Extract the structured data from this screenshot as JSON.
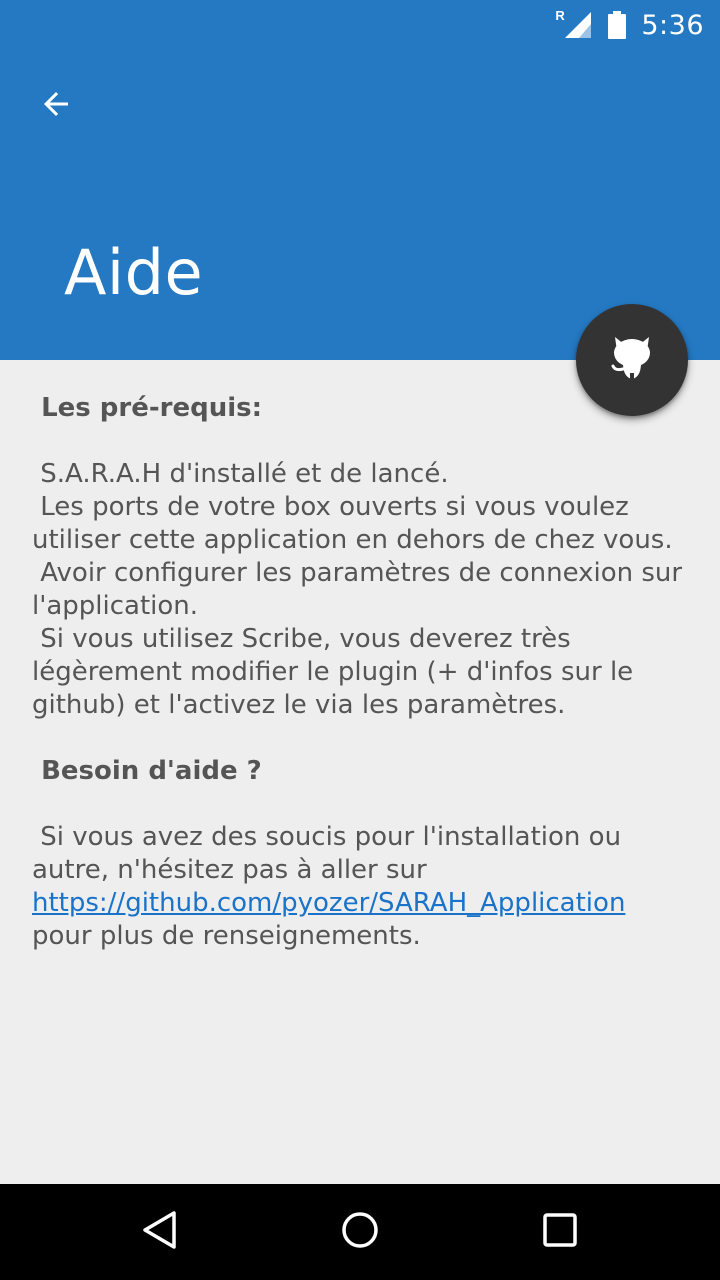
{
  "status_bar": {
    "time": "5:36",
    "network_label": "R",
    "signal_icon": "signal-roaming-icon",
    "battery_icon": "battery-full-icon"
  },
  "app_bar": {
    "back_icon": "arrow-back-icon",
    "title": "Aide",
    "color": "#2479c2"
  },
  "fab": {
    "icon": "github-octocat-icon",
    "color": "#333333"
  },
  "content": {
    "prereq_heading": "Les pré-requis:",
    "prereq_lines": [
      "S.A.R.A.H d'installé et de lancé.",
      "Les ports de votre box ouverts si vous voulez utiliser cette application en dehors de chez vous.",
      "Avoir configurer les paramètres de connexion sur l'application.",
      "Si vous utilisez Scribe, vous deverez très légèrement modifier le plugin (+ d'infos sur le github) et l'activez le via les paramètres."
    ],
    "help_heading": "Besoin d'aide ?",
    "help_text_before": "Si vous avez des soucis pour l'installation ou autre, n'hésitez pas à aller sur ",
    "help_link": "https://github.com/pyozer/SARAH_Application",
    "help_text_after": " pour plus de renseignements.",
    "link_color": "#1a73c9"
  },
  "nav_bar": {
    "back_icon": "nav-back-triangle-icon",
    "home_icon": "nav-home-circle-icon",
    "recents_icon": "nav-recents-square-icon"
  }
}
